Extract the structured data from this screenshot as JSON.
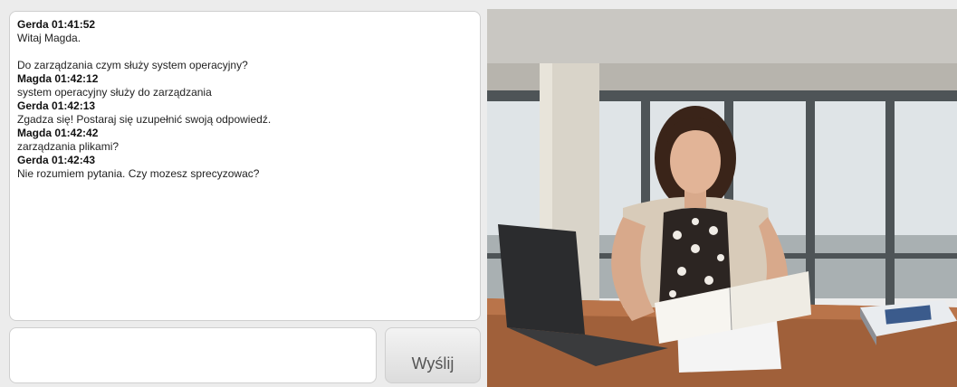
{
  "chat": {
    "messages": [
      {
        "author": "Gerda 01:41:52",
        "lines": [
          "Witaj Magda.",
          "",
          "Do zarządzania czym służy system operacyjny?"
        ]
      },
      {
        "author": "Magda 01:42:12",
        "lines": [
          "system operacyjny służy do zarządzania"
        ]
      },
      {
        "author": "Gerda 01:42:13",
        "lines": [
          "Zgadza się! Postaraj się uzupełnić swoją odpowiedź."
        ]
      },
      {
        "author": "Magda 01:42:42",
        "lines": [
          "zarządzania plikami?"
        ]
      },
      {
        "author": "Gerda 01:42:43",
        "lines": [
          "Nie rozumiem pytania. Czy mozesz sprecyzowac?"
        ]
      }
    ]
  },
  "input": {
    "value": ""
  },
  "send_button": {
    "label": "Wyślij"
  }
}
